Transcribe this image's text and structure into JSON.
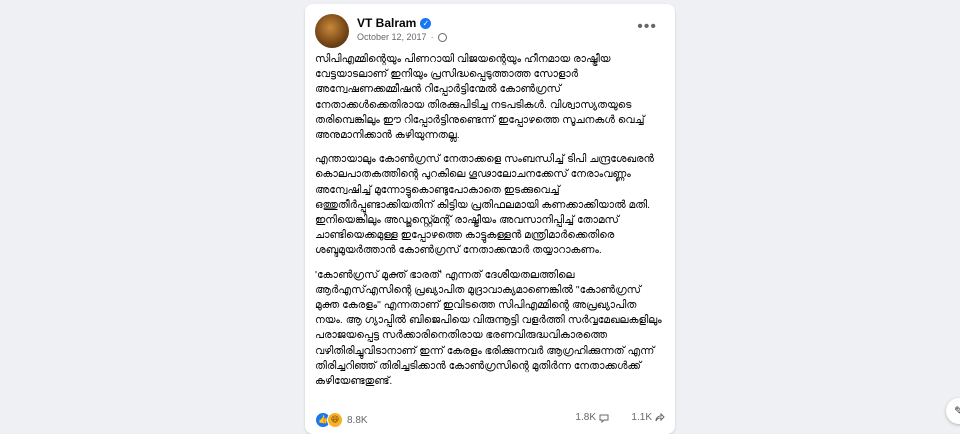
{
  "post": {
    "author": "VT Balram",
    "date": "October 12, 2017",
    "paragraphs": [
      "സിപിഎമ്മിന്റെയും പിണറായി വിജയന്റെയും ഹീനമായ രാഷ്ട്രീയ വേട്ടയാടലാണ് ഇനിയും പ്രസിദ്ധപ്പെടുത്താത്ത സോളാർ അന്വേഷണക്കമ്മീഷൻ റിപ്പോർട്ടിന്മേൽ കോൺഗ്രസ് നേതാക്കൾക്കെതിരായ തിരക്കുപിടിച്ച നടപടികൾ. വിശ്വാസ്യതയുടെ തരിമ്പെങ്കിലും ഈ റിപ്പോർട്ടിനുണ്ടെന്ന് ഇപ്പോഴത്തെ സൂചനകൾ വെച്ച് അനുമാനിക്കാൻ കഴിയുന്നതല്ല.",
      "എന്തായാലും കോൺഗ്രസ് നേതാക്കളെ സംബന്ധിച്ച് ടിപി ചന്ദ്രശേഖരൻ കൊലപാതകത്തിന്റെ പുറകിലെ ഗൂഢാലോചനക്കേസ് നേരാംവണ്ണം അന്വേഷിച്ച് മുന്നോട്ടുകൊണ്ടുപോകാതെ ഇടക്കുവെച്ച് ഒത്തുതീർപ്പുണ്ടാക്കിയതിന് കിട്ടിയ പ്രതിഫലമായി കണക്കാക്കിയാൽ മതി. ഇനിയെങ്കിലും അഡ്ജസ്റ്റ്മെന്റ് രാഷ്ട്രീയം അവസാനിപ്പിച്ച് തോമസ് ചാണ്ടിയെക്കമുള്ള ഇപ്പോഴത്തെ കാട്ടുകള്ളൻ മന്ത്രിമാർക്കെതിരെ ശബ്ദമുയർത്താൻ കോൺഗ്രസ് നേതാക്കന്മാർ തയ്യാറാകണം.",
      "'കോൺഗ്രസ് മുക്ത് ഭാരത്' എന്നത് ദേശീയതലത്തിലെ ആർഎസ്എസിന്റെ പ്രഖ്യാപിത മുദ്രാവാക്യമാണെങ്കിൽ \"കോൺഗ്രസ് മുക്ത കേരളം\" എന്നതാണ് ഇവിടത്തെ സിപിഎമ്മിന്റെ അപ്രഖ്യാപിത നയം. ആ ഗ്യാപ്പിൽ ബിജെപിയെ വിരുന്നൂട്ടി വളർത്തി സർവ്വമേഖലകളിലും പരാജയപ്പെട്ട സർക്കാരിനെതിരായ ഭരണവിരുദ്ധവികാരത്തെ വഴിതിരിച്ചുവിടാനാണ് ഇന്ന് കേരളം ഭരിക്കുന്നവർ ആഗ്രഹിക്കുന്നത് എന്ന് തിരിച്ചറിഞ്ഞ് തിരിച്ചടിക്കാൻ കോൺഗ്രസിന്റെ മുതിർന്ന നേതാക്കൾക്ക് കഴിയേണ്ടതുണ്ട്."
    ],
    "reaction_count": "8.8K",
    "comment_count": "1.8K",
    "share_count": "1.1K"
  },
  "icons": {
    "verified": "verified-badge-icon",
    "privacy": "globe-icon",
    "more": "more-options-icon",
    "like": "like-reaction-icon",
    "haha": "haha-reaction-icon",
    "comment": "comment-icon",
    "share": "share-icon"
  },
  "colors": {
    "accent": "#1877f2",
    "text": "#050505",
    "muted": "#65676b"
  }
}
